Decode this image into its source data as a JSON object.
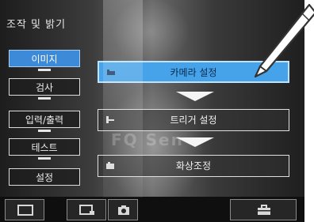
{
  "header": {
    "title": "조작 및 밝기"
  },
  "sidebar": {
    "items": [
      {
        "label": "이미지",
        "active": true
      },
      {
        "label": "검사",
        "active": false
      },
      {
        "label": "입력/출력",
        "active": false
      },
      {
        "label": "테스트",
        "active": false
      },
      {
        "label": "설정",
        "active": false
      }
    ]
  },
  "panel": {
    "buttons": [
      {
        "label": "카메라 설정",
        "icon": "camera-icon",
        "active": true
      },
      {
        "label": "트리거 설정",
        "icon": "trigger-icon",
        "active": false
      },
      {
        "label": "화상조정",
        "icon": "image-adjust-icon",
        "active": false
      }
    ],
    "watermark": "FQ Sen"
  },
  "bottom_bar": {
    "icons": [
      "screen-icon",
      "screen-edit-icon",
      "camera-icon",
      "toolbox-icon"
    ]
  },
  "colors": {
    "accent": "#46a3ea",
    "sidebar_active": "#3d8bd8"
  }
}
